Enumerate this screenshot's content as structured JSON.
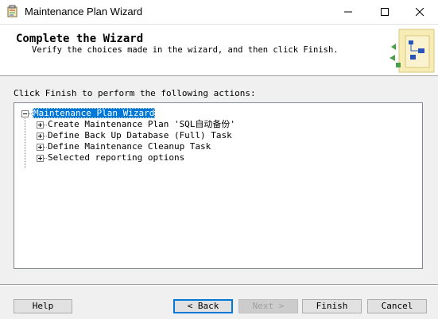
{
  "window": {
    "title": "Maintenance Plan Wizard",
    "controls": {
      "minimize": "minimize",
      "maximize": "maximize",
      "close": "close"
    }
  },
  "header": {
    "title": "Complete the Wizard",
    "subtitle": "Verify the choices made in the wizard, and then click Finish."
  },
  "instruction": "Click Finish to perform the following actions:",
  "tree": {
    "root": {
      "label": "Maintenance Plan Wizard",
      "expanded": true,
      "selected": true
    },
    "children": [
      {
        "label": "Create Maintenance Plan 'SQL自动备份'",
        "expanded": false
      },
      {
        "label": "Define Back Up Database (Full) Task",
        "expanded": false
      },
      {
        "label": "Define Maintenance Cleanup Task",
        "expanded": false
      },
      {
        "label": "Selected reporting options",
        "expanded": false
      }
    ]
  },
  "buttons": {
    "help": "Help",
    "back": "< Back",
    "next": "Next >",
    "finish": "Finish",
    "cancel": "Cancel"
  },
  "colors": {
    "selection": "#0078d7",
    "window_bg": "#f0f0f0"
  }
}
